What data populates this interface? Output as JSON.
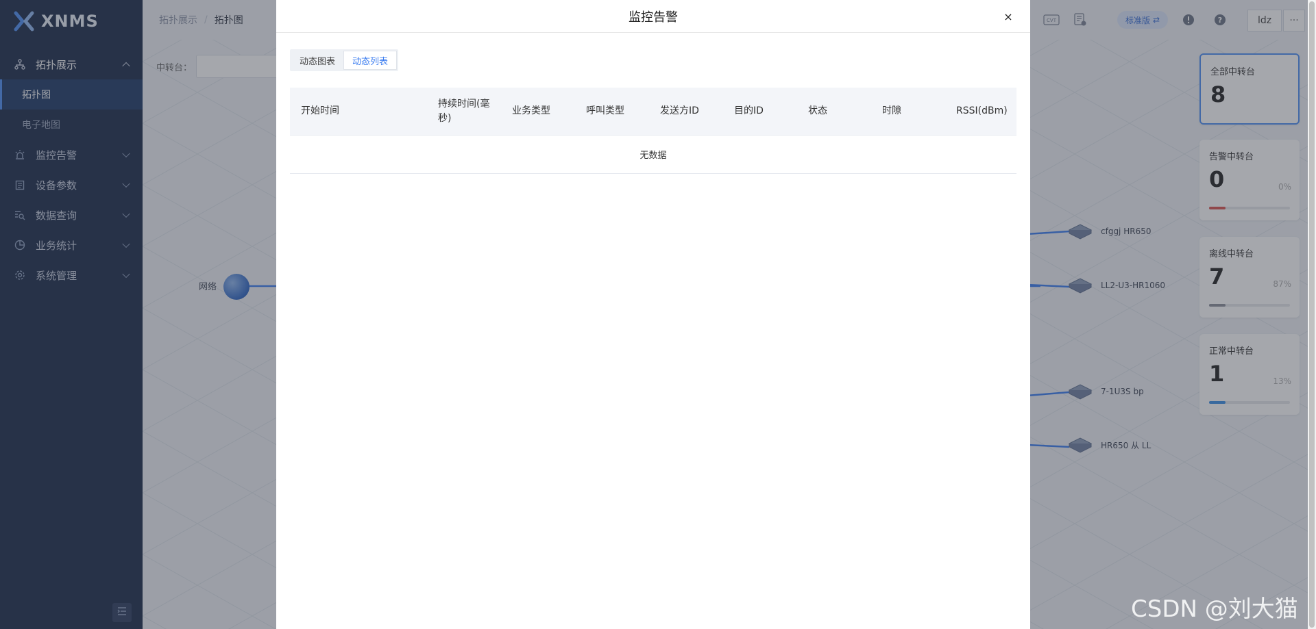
{
  "app": {
    "logo_text": "XNMS"
  },
  "sidebar": {
    "menu": [
      {
        "label": "拓扑展示",
        "icon": "topology-icon",
        "expanded": true,
        "children": [
          {
            "label": "拓扑图",
            "active": true
          },
          {
            "label": "电子地图",
            "active": false
          }
        ]
      },
      {
        "label": "监控告警",
        "icon": "alarm-icon"
      },
      {
        "label": "设备参数",
        "icon": "clipboard-icon"
      },
      {
        "label": "数据查询",
        "icon": "search-list-icon"
      },
      {
        "label": "业务统计",
        "icon": "pie-chart-icon"
      },
      {
        "label": "系统管理",
        "icon": "gear-icon"
      }
    ]
  },
  "header": {
    "breadcrumb": [
      "拓扑展示",
      "拓扑图"
    ],
    "filter_label": "中转台：",
    "edition_label": "标准版",
    "user_label": "ldz",
    "more_label": "···"
  },
  "topology": {
    "network_label": "网络",
    "nodes": [
      "cfggj  HR650",
      "LL2-U3-HR1060",
      "7-1U3S bp",
      "HR650 从 LL"
    ]
  },
  "stats": [
    {
      "title": "全部中转台",
      "value": "8",
      "percent": "",
      "bar_color": ""
    },
    {
      "title": "告警中转台",
      "value": "0",
      "percent": "0%",
      "bar_color": "#d9534f",
      "bar_fill": 0.2
    },
    {
      "title": "离线中转台",
      "value": "7",
      "percent": "87%",
      "bar_color": "#8a8f99",
      "bar_fill": 0.2
    },
    {
      "title": "正常中转台",
      "value": "1",
      "percent": "13%",
      "bar_color": "#3a8ee6",
      "bar_fill": 0.2
    }
  ],
  "modal": {
    "title": "监控告警",
    "close": "×",
    "tabs": [
      {
        "label": "动态图表",
        "active": false
      },
      {
        "label": "动态列表",
        "active": true
      }
    ],
    "table": {
      "columns": [
        "开始时间",
        "持续时间(毫秒)",
        "业务类型",
        "呼叫类型",
        "发送方ID",
        "目的ID",
        "状态",
        "时隙",
        "RSSI(dBm)"
      ],
      "empty_text": "无数据"
    }
  },
  "watermark": "CSDN @刘大猫"
}
